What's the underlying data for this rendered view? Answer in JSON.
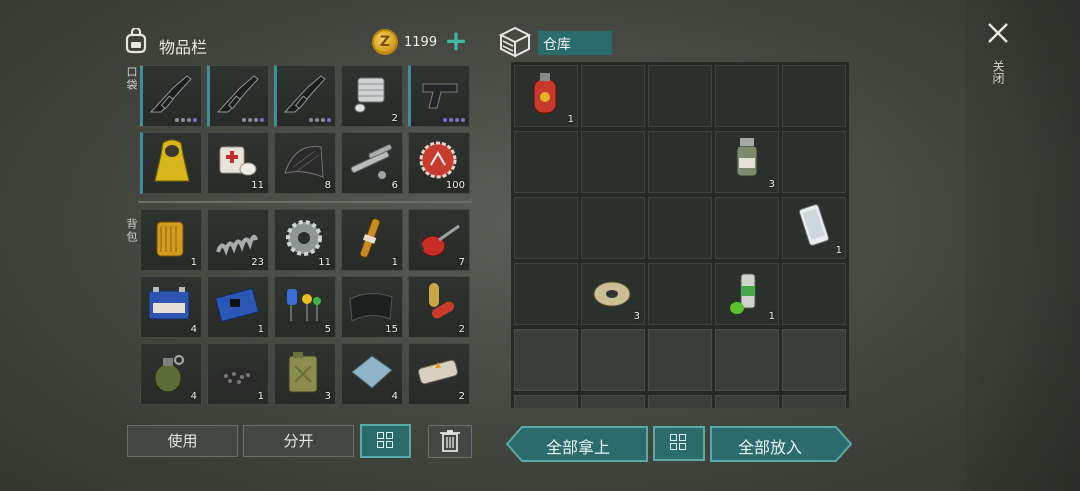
{
  "inventory": {
    "title": "物品栏",
    "coin_symbol": "Z",
    "coins": "1199",
    "pocket_label": "口袋",
    "backpack_label": "背包",
    "pocket": [
      {
        "icon": "rifle-icon",
        "qty": "",
        "quality_dots": 4
      },
      {
        "icon": "rifle-icon",
        "qty": "",
        "quality_dots": 4
      },
      {
        "icon": "rifle-icon",
        "qty": "",
        "quality_dots": 4
      },
      {
        "icon": "engine-part-icon",
        "qty": "2"
      },
      {
        "icon": "pistol-icon",
        "qty": "",
        "quality_dots": 4
      },
      {
        "icon": "hazmat-suit-icon",
        "qty": ""
      },
      {
        "icon": "bandage-icon",
        "qty": "11"
      },
      {
        "icon": "rubber-mat-icon",
        "qty": "8"
      },
      {
        "icon": "metal-pipe-icon",
        "qty": "6"
      },
      {
        "icon": "bottle-cap-icon",
        "qty": "100"
      }
    ],
    "backpack": [
      {
        "icon": "oil-filter-icon",
        "qty": "1"
      },
      {
        "icon": "spring-icon",
        "qty": "23"
      },
      {
        "icon": "gear-icon",
        "qty": "11"
      },
      {
        "icon": "ampoule-icon",
        "qty": "1"
      },
      {
        "icon": "oil-can-icon",
        "qty": "7"
      },
      {
        "icon": "battery-icon",
        "qty": "4"
      },
      {
        "icon": "circuit-board-icon",
        "qty": "1"
      },
      {
        "icon": "electronic-parts-icon",
        "qty": "5"
      },
      {
        "icon": "cloth-icon",
        "qty": "15"
      },
      {
        "icon": "pill-capsule-icon",
        "qty": "2"
      },
      {
        "icon": "grenade-icon",
        "qty": "4"
      },
      {
        "icon": "gravel-icon",
        "qty": "1"
      },
      {
        "icon": "jerrycan-icon",
        "qty": "3"
      },
      {
        "icon": "metal-plate-icon",
        "qty": "4"
      },
      {
        "icon": "explosive-icon",
        "qty": "2"
      }
    ],
    "use_button": "使用",
    "split_button": "分开",
    "sort_icon": "grid-sort-icon",
    "trash_icon": "trash-icon"
  },
  "storage": {
    "icon": "storage-box-icon",
    "title": "仓库",
    "items": [
      {
        "row": 0,
        "col": 0,
        "icon": "gas-cylinder-icon",
        "qty": "1"
      },
      {
        "row": 1,
        "col": 3,
        "icon": "medicine-bottle-icon",
        "qty": "3"
      },
      {
        "row": 2,
        "col": 4,
        "icon": "smartphone-icon",
        "qty": "1"
      },
      {
        "row": 3,
        "col": 1,
        "icon": "wire-spool-icon",
        "qty": "3"
      },
      {
        "row": 3,
        "col": 3,
        "icon": "spray-can-icon",
        "qty": "1"
      }
    ],
    "take_all_button": "全部拿上",
    "put_all_button": "全部放入"
  },
  "close": {
    "label": "关闭",
    "icon": "close-icon"
  },
  "colors": {
    "accent_teal": "#2b6b6c",
    "coin_gold": "#d9a21e",
    "equip_bar": "#3e8f96"
  }
}
